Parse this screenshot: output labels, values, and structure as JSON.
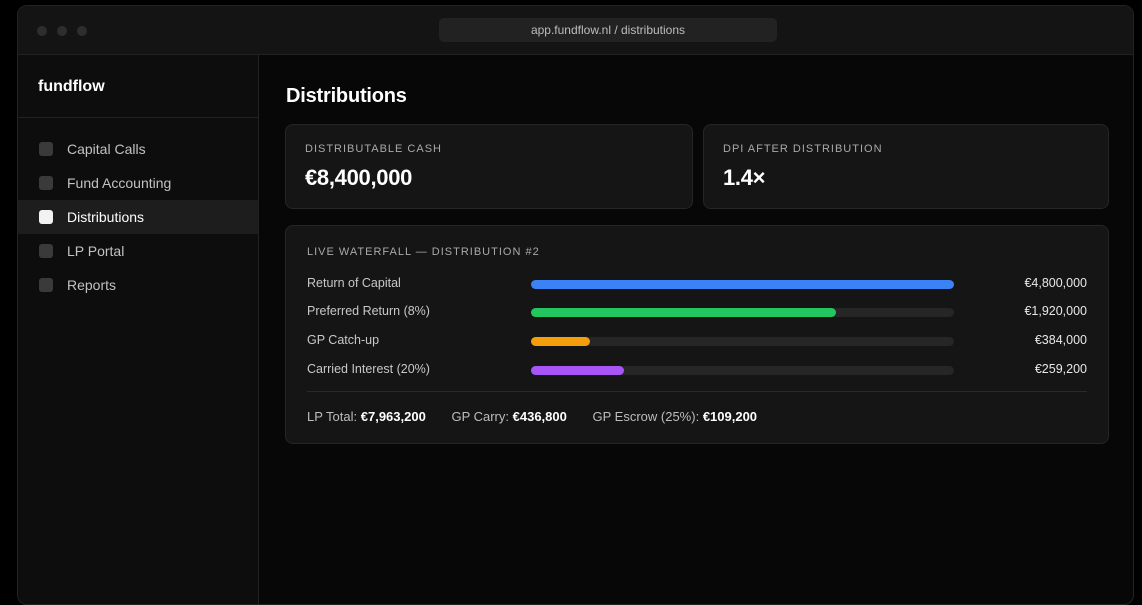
{
  "browser": {
    "url": "app.fundflow.nl / distributions"
  },
  "sidebar": {
    "brand": "fundflow",
    "items": [
      {
        "label": "Capital Calls",
        "active": false
      },
      {
        "label": "Fund Accounting",
        "active": false
      },
      {
        "label": "Distributions",
        "active": true
      },
      {
        "label": "LP Portal",
        "active": false
      },
      {
        "label": "Reports",
        "active": false
      }
    ]
  },
  "main": {
    "title": "Distributions",
    "stats": [
      {
        "label": "DISTRIBUTABLE CASH",
        "value": "€8,400,000"
      },
      {
        "label": "DPI AFTER DISTRIBUTION",
        "value": "1.4×"
      }
    ],
    "waterfall": {
      "title": "LIVE WATERFALL — DISTRIBUTION #2",
      "rows": [
        {
          "label": "Return of Capital",
          "amount": "€4,800,000",
          "fill_fraction": 1.0,
          "color": "#3b82f6"
        },
        {
          "label": "Preferred Return (8%)",
          "amount": "€1,920,000",
          "fill_fraction": 0.72,
          "color": "#22c55e"
        },
        {
          "label": "GP Catch-up",
          "amount": "€384,000",
          "fill_fraction": 0.14,
          "color": "#f59e0b"
        },
        {
          "label": "Carried Interest (20%)",
          "amount": "€259,200",
          "fill_fraction": 0.22,
          "color": "#a855f7"
        }
      ],
      "totals": {
        "lp_label": "LP Total:",
        "lp_value": "€7,963,200",
        "gp_carry_label": "GP Carry:",
        "gp_carry_value": "€436,800",
        "gp_escrow_label": "GP Escrow (25%):",
        "gp_escrow_value": "€109,200"
      }
    }
  }
}
